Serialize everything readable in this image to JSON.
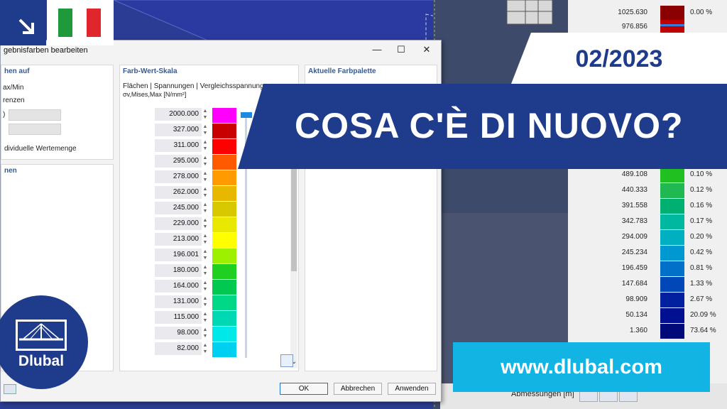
{
  "dialog": {
    "title": "gebnisfarben bearbeiten",
    "minimize": "—",
    "maximize": "☐",
    "close": "✕",
    "left_panel": {
      "header": "hen auf",
      "opt_maxmin": "ax/Min",
      "opt_grenzen": "renzen",
      "paren": ")",
      "opt_individual": "dividuelle Wertemenge",
      "header2": "nen"
    },
    "scale_panel": {
      "header": "Farb-Wert-Skala",
      "subtitle": "Flächen | Spannungen | Vergleichsspannungen",
      "quantity": "σv,Mises,Max [N/mm²]",
      "values": [
        "2000.000",
        "327.000",
        "311.000",
        "295.000",
        "278.000",
        "262.000",
        "245.000",
        "229.000",
        "213.000",
        "196.001",
        "180.000",
        "164.000",
        "131.000",
        "115.000",
        "98.000",
        "82.000"
      ],
      "colors": [
        "#ff00ff",
        "#c80000",
        "#ff0000",
        "#ff5a00",
        "#ff9a00",
        "#e8b800",
        "#d8c800",
        "#e8e800",
        "#ffff00",
        "#9cf000",
        "#20d020",
        "#00c850",
        "#00d888",
        "#00d8b4",
        "#00e8e8",
        "#00d0f0"
      ],
      "scroll_down": "⌄"
    },
    "palette_panel": {
      "header": "Aktuelle Farbpalette"
    },
    "buttons": {
      "ok": "OK",
      "cancel": "Abbrechen",
      "apply": "Anwenden"
    }
  },
  "legend": {
    "rows": [
      {
        "value": "1025.630",
        "color": "#8b0000",
        "pct": "0.00 %"
      },
      {
        "value": "976.856",
        "color": "#c00000",
        "pct": ""
      },
      {
        "value": "489.108",
        "color": "#20c020",
        "pct": "0.10 %"
      },
      {
        "value": "440.333",
        "color": "#20b850",
        "pct": "0.12 %"
      },
      {
        "value": "391.558",
        "color": "#00b070",
        "pct": "0.16 %"
      },
      {
        "value": "342.783",
        "color": "#00b8a0",
        "pct": "0.17 %"
      },
      {
        "value": "294.009",
        "color": "#00b0c0",
        "pct": "0.20 %"
      },
      {
        "value": "245.234",
        "color": "#0098d0",
        "pct": "0.42 %"
      },
      {
        "value": "196.459",
        "color": "#0070c8",
        "pct": "0.81 %"
      },
      {
        "value": "147.684",
        "color": "#0048b8",
        "pct": "1.33 %"
      },
      {
        "value": "98.909",
        "color": "#0020a0",
        "pct": "2.67 %"
      },
      {
        "value": "50.134",
        "color": "#001090",
        "pct": "20.09 %"
      },
      {
        "value": "1.360",
        "color": "#000a78",
        "pct": "73.64 %"
      }
    ],
    "dimensions_label": "Abmessungen [m]"
  },
  "banners": {
    "date": "02/2023",
    "headline": "COSA C'È DI NUOVO?",
    "url": "www.dlubal.com",
    "logo": "Dlubal"
  }
}
